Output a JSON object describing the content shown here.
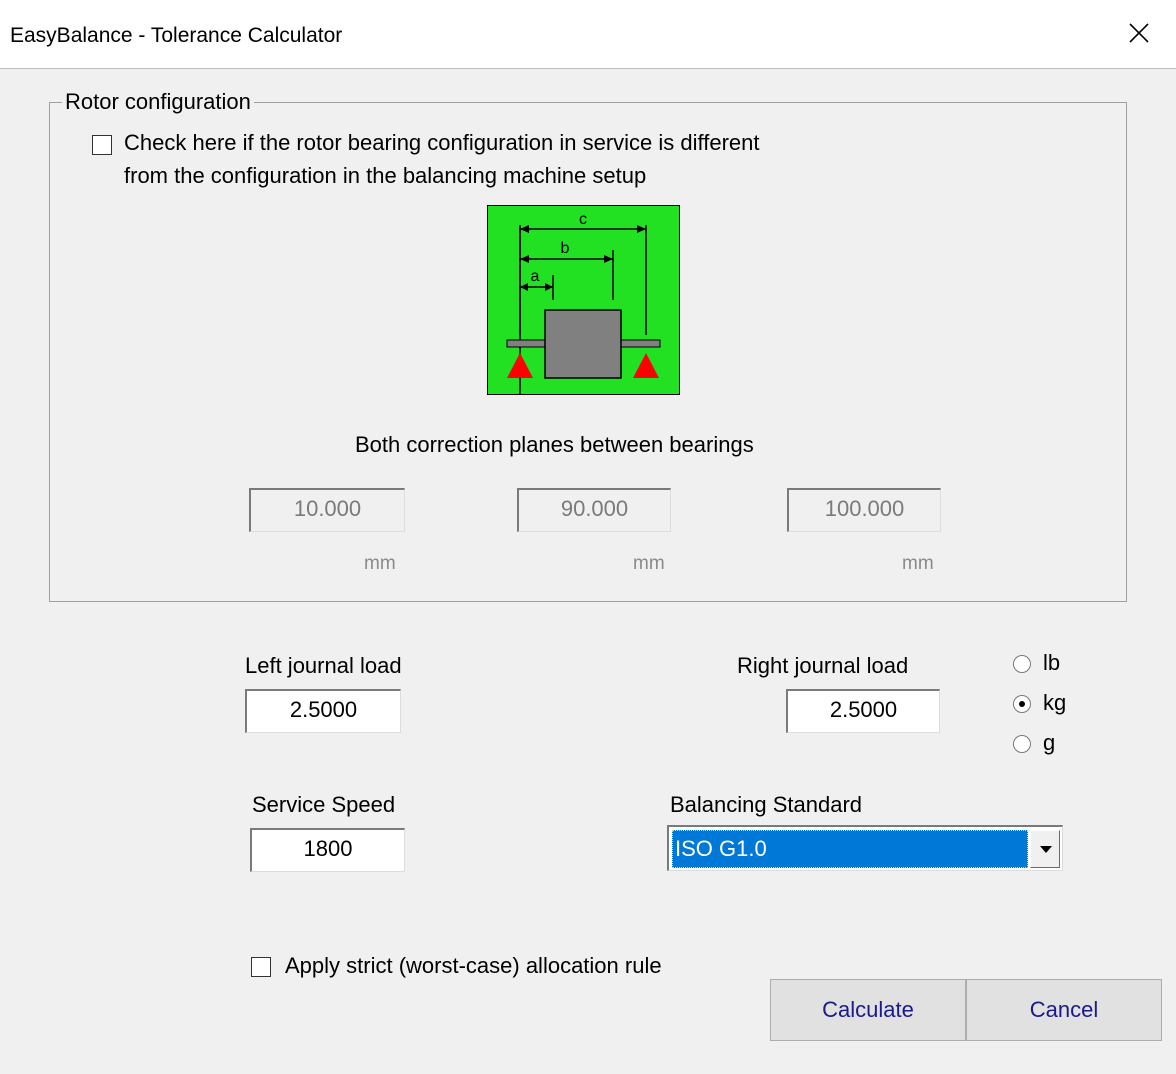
{
  "window": {
    "title": "EasyBalance - Tolerance Calculator"
  },
  "rotor_group": {
    "legend": "Rotor configuration",
    "checkbox_label_line1": "Check here if the rotor bearing configuration in service is different",
    "checkbox_label_line2": "from the configuration in the balancing machine setup",
    "diagram_labels": {
      "a": "a",
      "b": "b",
      "c": "c"
    },
    "diagram_caption": "Both correction planes between bearings",
    "fields": [
      {
        "value": "10.000",
        "unit": "mm"
      },
      {
        "value": "90.000",
        "unit": "mm"
      },
      {
        "value": "100.000",
        "unit": "mm"
      }
    ]
  },
  "loads": {
    "left_label": "Left journal load",
    "left_value": "2.5000",
    "right_label": "Right journal load",
    "right_value": "2.5000",
    "units": [
      {
        "label": "lb",
        "selected": false
      },
      {
        "label": "kg",
        "selected": true
      },
      {
        "label": "g",
        "selected": false
      }
    ]
  },
  "speed": {
    "label": "Service Speed",
    "value": "1800"
  },
  "standard": {
    "label": "Balancing Standard",
    "value": "ISO G1.0"
  },
  "strict_rule": {
    "label": "Apply strict (worst-case) allocation rule"
  },
  "buttons": {
    "calculate": "Calculate",
    "cancel": "Cancel"
  },
  "colors": {
    "diagram_bg": "#22e022",
    "bearing": "#ff0000",
    "rotor": "#808080",
    "selection": "#0078d7"
  }
}
